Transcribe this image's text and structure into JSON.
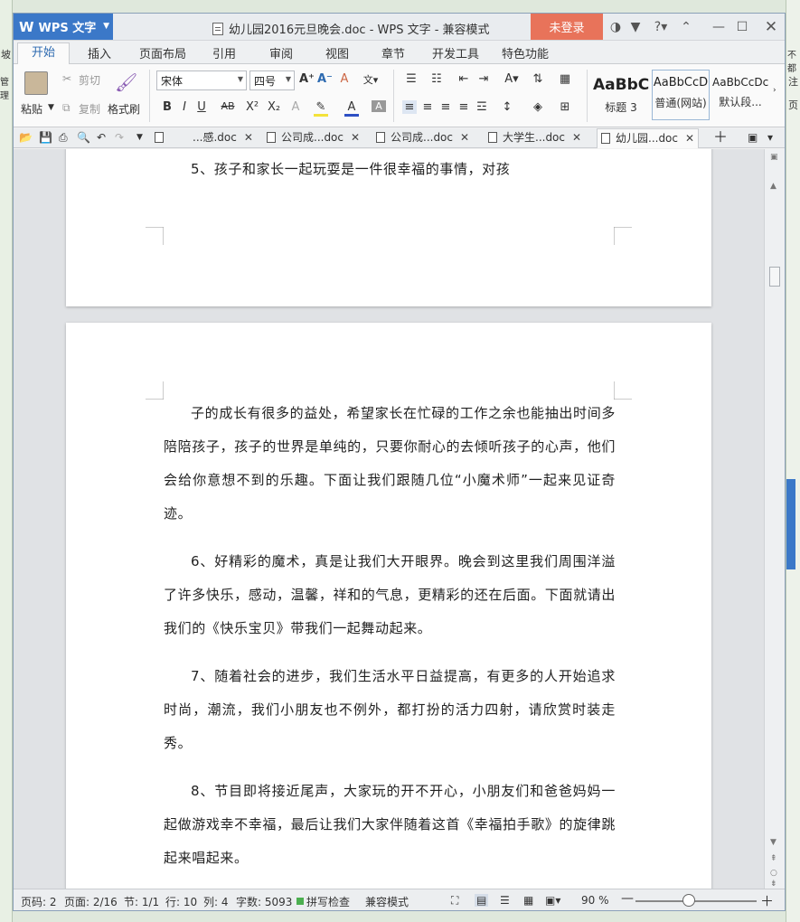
{
  "window": {
    "app_name": "WPS 文字",
    "title": "幼儿园2016元旦晚会.doc - WPS 文字 - 兼容模式",
    "login_label": "未登录"
  },
  "ribbon_tabs": [
    "开始",
    "插入",
    "页面布局",
    "引用",
    "审阅",
    "视图",
    "章节",
    "开发工具",
    "特色功能"
  ],
  "ribbon": {
    "paste": "粘贴",
    "cut": "剪切",
    "copy": "复制",
    "format_painter": "格式刷",
    "font_name": "宋体",
    "font_size": "四号",
    "styles": [
      {
        "sample": "AaBbC",
        "name": "标题 3"
      },
      {
        "sample": "AaBbCcD",
        "name": "普通(网站)"
      },
      {
        "sample": "AaBbCcDc",
        "name": "默认段..."
      }
    ]
  },
  "doc_tabs": [
    {
      "label": "...感.doc",
      "active": false
    },
    {
      "label": "公司成...doc",
      "active": false
    },
    {
      "label": "公司成...doc",
      "active": false
    },
    {
      "label": "大学生...doc",
      "active": false
    },
    {
      "label": "幼儿园...doc",
      "active": true
    }
  ],
  "document": {
    "page1_tail": "5、孩子和家长一起玩耍是一件很幸福的事情，对孩",
    "paragraphs": [
      "子的成长有很多的益处，希望家长在忙碌的工作之余也能抽出时间多陪陪孩子，孩子的世界是单纯的，只要你耐心的去倾听孩子的心声，他们会给你意想不到的乐趣。下面让我们跟随几位“小魔术师”一起来见证奇迹。",
      "6、好精彩的魔术，真是让我们大开眼界。晚会到这里我们周围洋溢了许多快乐，感动，温馨，祥和的气息，更精彩的还在后面。下面就请出我们的《快乐宝贝》带我们一起舞动起来。",
      "7、随着社会的进步，我们生活水平日益提高，有更多的人开始追求时尚，潮流，我们小朋友也不例外，都打扮的活力四射，请欣赏时装走秀。",
      "8、节目即将接近尾声，大家玩的开不开心，小朋友们和爸爸妈妈一起做游戏幸不幸福，最后让我们大家伴随着这首《幸福拍手歌》的旋律跳起来唱起来。"
    ]
  },
  "status": {
    "page_code": "页码: 2",
    "page": "页面: 2/16",
    "section": "节: 1/1",
    "row": "行: 10",
    "col": "列: 4",
    "word_count": "字数: 5093",
    "spell_check": "拼写检查",
    "compat": "兼容模式",
    "zoom": "90 %"
  },
  "background": {
    "left_snippets": [
      "坡",
      "管理"
    ],
    "right_snippets": [
      "不都",
      "注",
      "页"
    ]
  }
}
